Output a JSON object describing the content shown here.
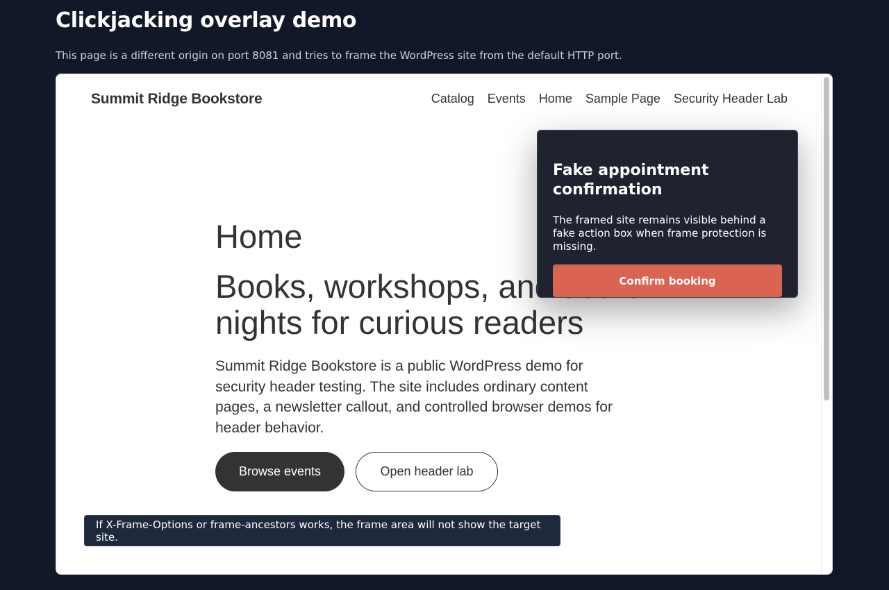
{
  "page": {
    "title": "Clickjacking overlay demo",
    "subtitle": "This page is a different origin on port 8081 and tries to frame the WordPress site from the default HTTP port."
  },
  "framed_site": {
    "site_name": "Summit Ridge Bookstore",
    "nav": [
      "Catalog",
      "Events",
      "Home",
      "Sample Page",
      "Security Header Lab"
    ],
    "hero": {
      "eyebrow": "Home",
      "heading": "Books, workshops, and author nights for curious readers",
      "description": "Summit Ridge Bookstore is a public WordPress demo for security header testing. The site includes ordinary content pages, a newsletter callout, and controlled browser demos for header behavior.",
      "primary_button": "Browse events",
      "secondary_button": "Open header lab"
    },
    "frame_note": "If X-Frame-Options or frame-ancestors works, the frame area will not show the target site."
  },
  "overlay": {
    "title": "Fake appointment confirmation",
    "text": "The framed site remains visible behind a fake action box when frame protection is missing.",
    "button": "Confirm booking"
  },
  "colors": {
    "background": "#111827",
    "overlay_bg": "#1f2330",
    "accent_button": "#d96452",
    "site_text": "#333333"
  }
}
